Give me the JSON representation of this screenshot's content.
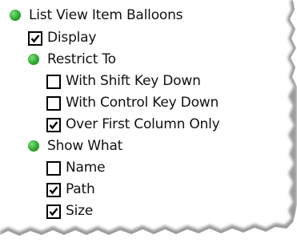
{
  "options_tree": {
    "items": [
      {
        "kind": "bullet",
        "label": "List View Item Balloons"
      },
      {
        "kind": "checkbox",
        "label": "Display",
        "checked": true
      },
      {
        "kind": "bullet",
        "label": "Restrict To"
      },
      {
        "kind": "checkbox",
        "label": "With Shift Key Down",
        "checked": false
      },
      {
        "kind": "checkbox",
        "label": "With Control Key Down",
        "checked": false
      },
      {
        "kind": "checkbox",
        "label": "Over First Column Only",
        "checked": true
      },
      {
        "kind": "bullet",
        "label": "Show What"
      },
      {
        "kind": "checkbox",
        "label": "Name",
        "checked": false
      },
      {
        "kind": "checkbox",
        "label": "Path",
        "checked": true
      },
      {
        "kind": "checkbox",
        "label": "Size",
        "checked": true
      }
    ]
  },
  "colors": {
    "bullet": "#2fa82f",
    "background": "#ffffff",
    "shadow": "#8a8a8a"
  }
}
